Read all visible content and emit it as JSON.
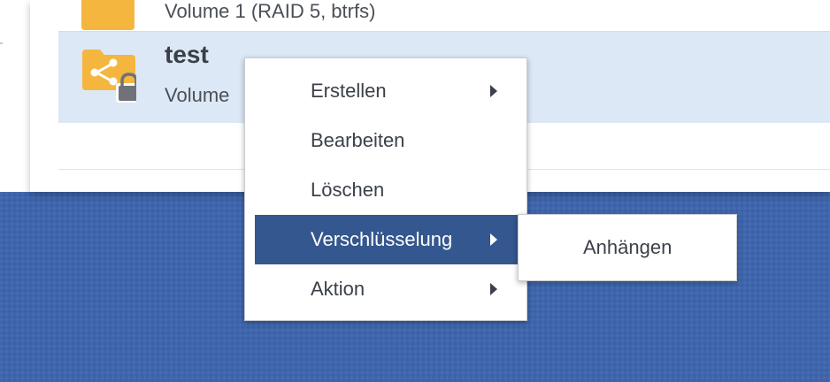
{
  "file_list": {
    "rows": [
      {
        "name": "",
        "subtitle": "Volume 1 (RAID 5, btrfs)",
        "icon": "shared-folder-icon",
        "selected": false
      },
      {
        "name": "test",
        "subtitle": "Volume",
        "icon": "encrypted-shared-folder-icon",
        "locked": true,
        "selected": true
      }
    ]
  },
  "context_menu": {
    "items": [
      {
        "label": "Erstellen",
        "has_submenu": true
      },
      {
        "label": "Bearbeiten",
        "has_submenu": false
      },
      {
        "label": "Löschen",
        "has_submenu": false
      },
      {
        "label": "Verschlüsselung",
        "has_submenu": true,
        "active": true
      },
      {
        "label": "Aktion",
        "has_submenu": true
      }
    ],
    "submenu": {
      "items": [
        {
          "label": "Anhängen"
        }
      ]
    }
  },
  "colors": {
    "desktop_background": "#3f66ad",
    "selected_row": "#dde8f6",
    "menu_highlight": "#34578f",
    "folder": "#f4b63f",
    "lock": "#6f7278",
    "text": "#3b4049"
  }
}
